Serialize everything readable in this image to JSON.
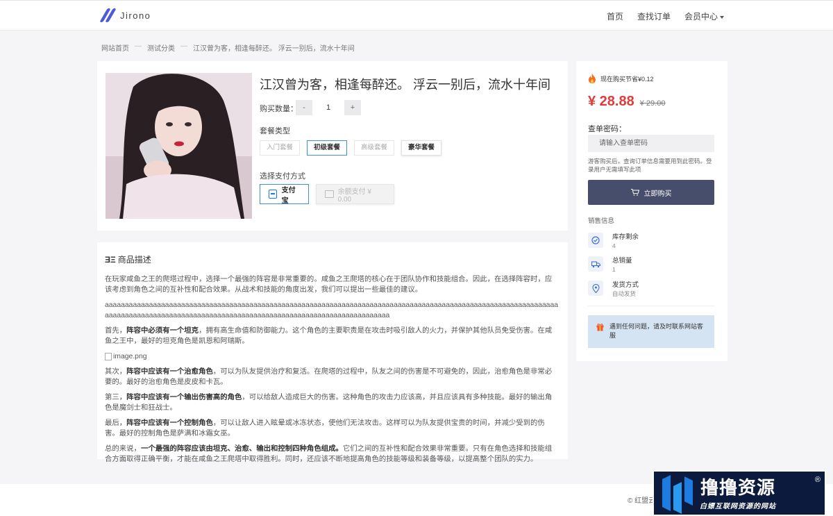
{
  "header": {
    "brand": "Jirono",
    "nav": [
      "首页",
      "查找订单",
      "会员中心"
    ]
  },
  "breadcrumb": [
    "网站首页",
    "测试分类",
    "江汉曾为客，相逢每醉还。 浮云一别后，流水十年间"
  ],
  "product": {
    "title": "江汉曾为客，相逢每醉还。 浮云一别后，流水十年间",
    "qty_label": "购买数量：",
    "qty_minus": "-",
    "qty_value": "1",
    "qty_plus": "+",
    "plan_label": "套餐类型",
    "plans": [
      "入门套餐",
      "初级套餐",
      "高级套餐",
      "豪华套餐"
    ],
    "pay_label": "选择支付方式",
    "pay_alipay": "支付宝",
    "pay_balance": "余额支付 ¥ 0.00"
  },
  "description": {
    "heading": "商品描述",
    "p1": "在玩家咸鱼之王的爬塔过程中，选择一个最强的阵容是非常重要的。咸鱼之王爬塔的核心在于团队协作和技能组合。因此，在选择阵容时，应该考虑到角色之间的互补性和配合效果。从战术和技能的角度出发，我们可以提出一些最佳的建议。",
    "p2": "aaaaaaaaaaaaaaaaaaaaaaaaaaaaaaaaaaaaaaaaaaaaaaaaaaaaaaaaaaaaaaaaaaaaaaaaaaaaaaaaaaaaaaaaaaaaaaaaaaaaaaaaaaaaaaaaaaaaaaaaaaaaaaaaaaaaaaaaaaaaaaaaaaaaaaaaaaaaaaaaaaaaaaaaaaaaaaaaaaaaaaaa",
    "p3_pre": "首先，",
    "p3_bold": "阵容中必须有一个坦克",
    "p3_post": "，拥有高生命值和防御能力。这个角色的主要职责是在攻击时吸引敌人的火力，并保护其他队员免受伤害。在咸鱼之王中，最好的坦克角色是凯恩和阿瑞斯。",
    "image_alt": "image.png",
    "p4_pre": "其次，",
    "p4_bold": "阵容中应该有一个治愈角色",
    "p4_post": "，可以为队友提供治疗和复活。在爬塔的过程中，队友之间的伤害是不可避免的，因此，治愈角色是非常必要的。最好的治愈角色是皮皮和卡瓦。",
    "p5_pre": "第三，",
    "p5_bold": "阵容中应该有一个输出伤害高的角色",
    "p5_post": "，可以给敌人造成巨大的伤害。这种角色的攻击力应该高，并且应该具有多种技能。最好的输出角色是魔剑士和狂战士。",
    "p6_pre": "最后，",
    "p6_bold": "阵容中应该有一个控制角色",
    "p6_post": "，可以让敌人进入眩晕或冰冻状态，使他们无法攻击。这样可以为队友提供宝贵的时间，并减少受到的伤害。最好的控制角色是萨满和冰霜女巫。",
    "p7_pre": "总的来说，",
    "p7_bold": "一个最强的阵容应该由坦克、治愈、输出和控制四种角色组成。",
    "p7_post": "它们之间的互补性和配合效果非常重要。只有在角色选择和技能组合方面取得正确平衡，才能在咸鱼之王爬塔中取得胜利。同时，还应该不断地提高角色的技能等级和装备等级，以提高整个团队的实力。"
  },
  "sidebar": {
    "save_text": "现在购买节省¥0.12",
    "price": "¥ 28.88",
    "old_price": "¥ 29.00",
    "query_label": "查单密码：",
    "query_placeholder": "请输入查单密码",
    "hint": "游客购买后，查询订单信息需要用到此密码。登录用户无需填写此项",
    "buy_label": "立即购买",
    "sales_label": "销售信息",
    "stats": [
      {
        "title": "库存剩余",
        "value": "4"
      },
      {
        "title": "总销量",
        "value": "1"
      },
      {
        "title": "发货方式",
        "value": "自动发货"
      }
    ],
    "notice": "遇到任何问题，请及时联系网站客服"
  },
  "footer": {
    "copyright": "© 红盟云"
  },
  "watermark": {
    "title": "撸撸资源",
    "subtitle": "白嫖互联网资源的网站",
    "reg": "®"
  },
  "colors": {
    "accent": "#3b8ee0",
    "price": "#e23a3a",
    "buy_button": "#474e6b",
    "notice_bg": "#d5e4f2"
  }
}
